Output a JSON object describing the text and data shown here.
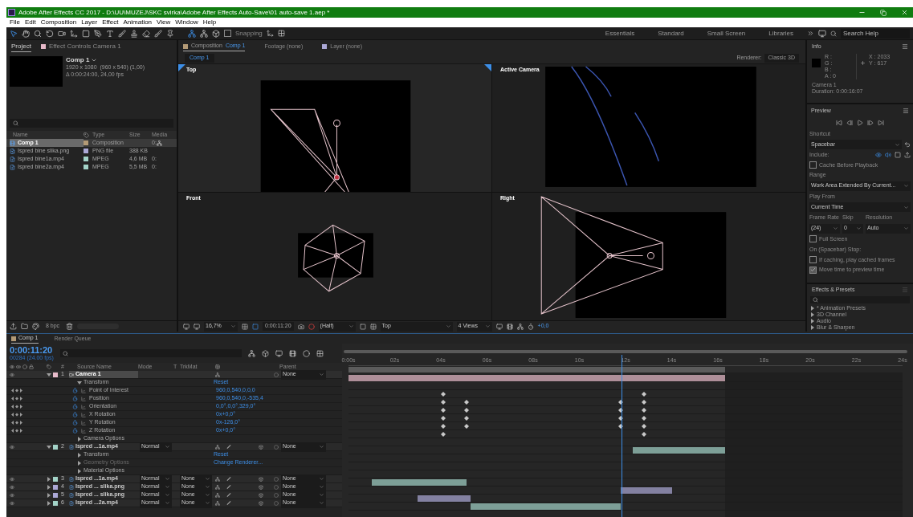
{
  "title_bar": {
    "title": "Adobe After Effects CC 2017 - D:\\UU\\MUZEJ\\SKC svirka\\Adobe After Effects Auto-Save\\01 auto-save 1.aep *"
  },
  "menu": [
    "File",
    "Edit",
    "Composition",
    "Layer",
    "Effect",
    "Animation",
    "View",
    "Window",
    "Help"
  ],
  "toolbar": {
    "snapping": {
      "label": "Snapping",
      "checked": false
    },
    "workspaces": [
      "Essentials",
      "Standard",
      "Small Screen",
      "Libraries"
    ],
    "search_help": {
      "placeholder": "Search Help"
    }
  },
  "project_panel": {
    "tabs": [
      {
        "label": "Project",
        "selected": true
      },
      {
        "label": "Effect Controls Camera 1",
        "selected": false
      }
    ],
    "comp": {
      "name": "Comp 1",
      "size": "1920 x 1080  (960 x 540) (1,00)",
      "duration": "Δ 0:00:24:00, 24,00 fps"
    },
    "columns": [
      "Name",
      "Type",
      "Size",
      "Media"
    ],
    "items": [
      {
        "kind": "composition",
        "name": "Comp 1",
        "type": "Composition",
        "media": "0:",
        "color": "#b39a76",
        "selected": true
      },
      {
        "kind": "image",
        "name": "Ispred bine slika.png",
        "type": "PNG file",
        "size": "388 KB",
        "color": "#aba8d6",
        "selected": false
      },
      {
        "kind": "video",
        "name": "Ispred bine1a.mp4",
        "type": "MPEG",
        "size": "4,6 MB",
        "media": "0:",
        "color": "#a3d3c8",
        "selected": false
      },
      {
        "kind": "video",
        "name": "Ispred bine2a.mp4",
        "type": "MPEG",
        "size": "5,5 MB",
        "media": "0:",
        "color": "#a3d3c8",
        "selected": false
      }
    ],
    "bpc": "8 bpc"
  },
  "viewer": {
    "tabs": [
      {
        "label": "Composition",
        "comp": "Comp 1",
        "selected": true
      },
      {
        "label": "Footage (none)",
        "selected": false
      },
      {
        "label": "Layer (none)",
        "selected": false
      }
    ],
    "breadcrumb": "Comp 1",
    "renderer_label": "Renderer:",
    "renderer": "Classic 3D",
    "views": [
      {
        "label": "Top",
        "kind": "top",
        "selected": true
      },
      {
        "label": "Active Camera",
        "kind": "active",
        "selected": false
      },
      {
        "label": "Front",
        "kind": "front",
        "selected": false
      },
      {
        "label": "Right",
        "kind": "right",
        "selected": false
      }
    ],
    "bottom_bar": {
      "zoom": "16,7%",
      "timecode": "0:00:11:20",
      "resolution": "(Half)",
      "view": "Top",
      "layout": "4 Views",
      "exposure": "+0,0"
    }
  },
  "info": {
    "title": "Info",
    "channels": [
      "R :",
      "G :",
      "B :",
      "A : 0"
    ],
    "coords": [
      "X : 2033",
      "Y : 617"
    ],
    "layer": "Camera 1",
    "duration": "Duration: 0:00:16:07"
  },
  "preview": {
    "title": "Preview",
    "shortcut_label": "Shortcut",
    "shortcut": "Spacebar",
    "include_label": "Include:",
    "cache": {
      "label": "Cache Before Playback",
      "checked": false
    },
    "range_label": "Range",
    "range": "Work Area Extended By Current...",
    "play_from_label": "Play From",
    "play_from": "Current Time",
    "frame_rate_label": "Frame Rate",
    "skip_label": "Skip",
    "resolution_label": "Resolution",
    "frame_rate": "(24)",
    "skip": "0",
    "resolution": "Auto",
    "full_screen": {
      "label": "Full Screen",
      "checked": false
    },
    "stop_label": "On (Spacebar) Stop:",
    "stop_options": [
      {
        "label": "If caching, play cached frames",
        "checked": false
      },
      {
        "label": "Move time to preview time",
        "checked": true
      }
    ]
  },
  "effects": {
    "title": "Effects & Presets",
    "items": [
      "* Animation Presets",
      "3D Channel",
      "Audio",
      "Blur & Sharpen"
    ]
  },
  "timeline": {
    "tabs": [
      {
        "label": "Comp 1",
        "selected": true
      },
      {
        "label": "Render Queue",
        "selected": false
      }
    ],
    "timecode": "0:00:11:20",
    "frame_info": "00284 (24.00 fps)",
    "columns": [
      "#",
      "Source Name",
      "Mode",
      "T",
      "TrkMat",
      "Parent"
    ],
    "ruler": [
      "0:00s",
      "02s",
      "04s",
      "06s",
      "08s",
      "10s",
      "12s",
      "14s",
      "16s",
      "18s",
      "20s",
      "22s",
      "24s"
    ],
    "playhead": {
      "level": 0.493
    },
    "rows": [
      {
        "kind": "camera_layer",
        "number": "1",
        "name": "Camera 1",
        "color": "#e8bccb",
        "expanded": true,
        "selected": true,
        "parent": "None"
      },
      {
        "kind": "group",
        "name": "Transform",
        "expanded": true,
        "disabled": false,
        "value": "Reset"
      },
      {
        "kind": "property",
        "name": "Point of Interest",
        "value": "960,0,540,0,0,0"
      },
      {
        "kind": "property",
        "name": "Position",
        "value": "960,0,540,0,-535,4"
      },
      {
        "kind": "property",
        "name": "Orientation",
        "value": "0,0°,0,0°,329,0°"
      },
      {
        "kind": "property",
        "name": "X Rotation",
        "value": "0x+0,0°"
      },
      {
        "kind": "property",
        "name": "Y Rotation",
        "value": "0x-126,0°"
      },
      {
        "kind": "property",
        "name": "Z Rotation",
        "value": "0x+0,0°"
      },
      {
        "kind": "group",
        "name": "Camera Options",
        "expanded": false,
        "disabled": false
      },
      {
        "kind": "footage_layer",
        "number": "2",
        "name": "Ispred ...1a.mp4",
        "color": "#a3d3c8",
        "expanded": true,
        "selected": false,
        "mode": "Normal",
        "parent": "None"
      },
      {
        "kind": "group",
        "name": "Transform",
        "expanded": false,
        "disabled": false,
        "value": "Reset"
      },
      {
        "kind": "group",
        "name": "Geometry Options",
        "expanded": false,
        "disabled": true,
        "value": "Change Renderer..."
      },
      {
        "kind": "group",
        "name": "Material Options",
        "expanded": false,
        "disabled": false
      },
      {
        "kind": "footage_layer",
        "number": "3",
        "name": "Ispred ...1a.mp4",
        "color": "#a3d3c8",
        "expanded": false,
        "selected": false,
        "mode": "Normal",
        "trkmat": "None",
        "parent": "None"
      },
      {
        "kind": "footage_layer",
        "number": "4",
        "name": "Ispred ... slika.png",
        "color": "#aba8d6",
        "expanded": false,
        "selected": false,
        "mode": "Normal",
        "trkmat": "None",
        "parent": "None"
      },
      {
        "kind": "footage_layer",
        "number": "5",
        "name": "Ispred ... slika.png",
        "color": "#aba8d6",
        "expanded": false,
        "selected": false,
        "mode": "Normal",
        "trkmat": "None",
        "parent": "None"
      },
      {
        "kind": "footage_layer",
        "number": "6",
        "name": "Ispred ...2a.mp4",
        "color": "#a3d3c8",
        "expanded": false,
        "selected": false,
        "mode": "Normal",
        "trkmat": "None",
        "parent": "None"
      }
    ]
  }
}
